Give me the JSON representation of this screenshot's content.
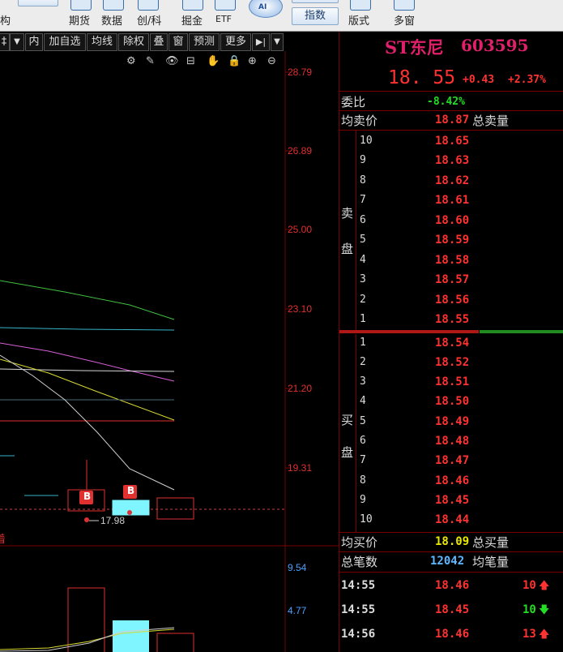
{
  "toolbar": {
    "left_cut": "构",
    "items": [
      "期货",
      "数据",
      "创/科",
      "掘金",
      "ETF"
    ],
    "ai_label": "AI",
    "index_button": "指数",
    "layout_label": "版式",
    "multi_window_label": "多窗"
  },
  "chart_toolbar": {
    "items": [
      "‡",
      "▼",
      "内",
      "加自选",
      "均线",
      "除权",
      "叠",
      "窗",
      "预测",
      "更多",
      "▶|",
      "▼"
    ]
  },
  "chart_tools": [
    "⚙",
    "✎",
    "👁",
    "⊟",
    "✋",
    "🔒",
    "⊕",
    "⊖"
  ],
  "price_axis": [
    "28.79",
    "26.89",
    "25.00",
    "23.10",
    "21.20",
    "19.31"
  ],
  "sub_axis": [
    "9.54",
    "4.77"
  ],
  "markers": {
    "b_label": "B",
    "low_label": "17.98",
    "left_cut_label": "着"
  },
  "stock": {
    "name": "ST东尼",
    "code": "603595",
    "price": "18. 55",
    "change": "+0.43",
    "change_pct": "+2.37%"
  },
  "order_book": {
    "weibi_label": "委比",
    "weibi_value": "-8.42%",
    "avg_sell_label": "均卖价",
    "avg_sell_value": "18.87",
    "total_sell_label": "总卖量",
    "sell_side_label": [
      "卖",
      "盘"
    ],
    "buy_side_label": [
      "买",
      "盘"
    ],
    "sell_levels": [
      {
        "level": "10",
        "price": "18.65"
      },
      {
        "level": "9",
        "price": "18.63"
      },
      {
        "level": "8",
        "price": "18.62"
      },
      {
        "level": "7",
        "price": "18.61"
      },
      {
        "level": "6",
        "price": "18.60"
      },
      {
        "level": "5",
        "price": "18.59"
      },
      {
        "level": "4",
        "price": "18.58"
      },
      {
        "level": "3",
        "price": "18.57"
      },
      {
        "level": "2",
        "price": "18.56"
      },
      {
        "level": "1",
        "price": "18.55"
      }
    ],
    "buy_levels": [
      {
        "level": "1",
        "price": "18.54"
      },
      {
        "level": "2",
        "price": "18.52"
      },
      {
        "level": "3",
        "price": "18.51"
      },
      {
        "level": "4",
        "price": "18.50"
      },
      {
        "level": "5",
        "price": "18.49"
      },
      {
        "level": "6",
        "price": "18.48"
      },
      {
        "level": "7",
        "price": "18.47"
      },
      {
        "level": "8",
        "price": "18.46"
      },
      {
        "level": "9",
        "price": "18.45"
      },
      {
        "level": "10",
        "price": "18.44"
      }
    ],
    "avg_buy_label": "均买价",
    "avg_buy_value": "18.09",
    "total_buy_label": "总买量",
    "total_trades_label": "总笔数",
    "total_trades_value": "12042",
    "avg_trade_label": "均笔量"
  },
  "trades": [
    {
      "time": "14:55",
      "price": "18.46",
      "volume": "10",
      "dir": "up"
    },
    {
      "time": "14:55",
      "price": "18.45",
      "volume": "10",
      "dir": "down"
    },
    {
      "time": "14:56",
      "price": "18.46",
      "volume": "13",
      "dir": "up"
    }
  ],
  "colors": {
    "up": "#ff3232",
    "down": "#22dd22",
    "accent_red": "#e03030",
    "stock_name": "#e0206a"
  }
}
